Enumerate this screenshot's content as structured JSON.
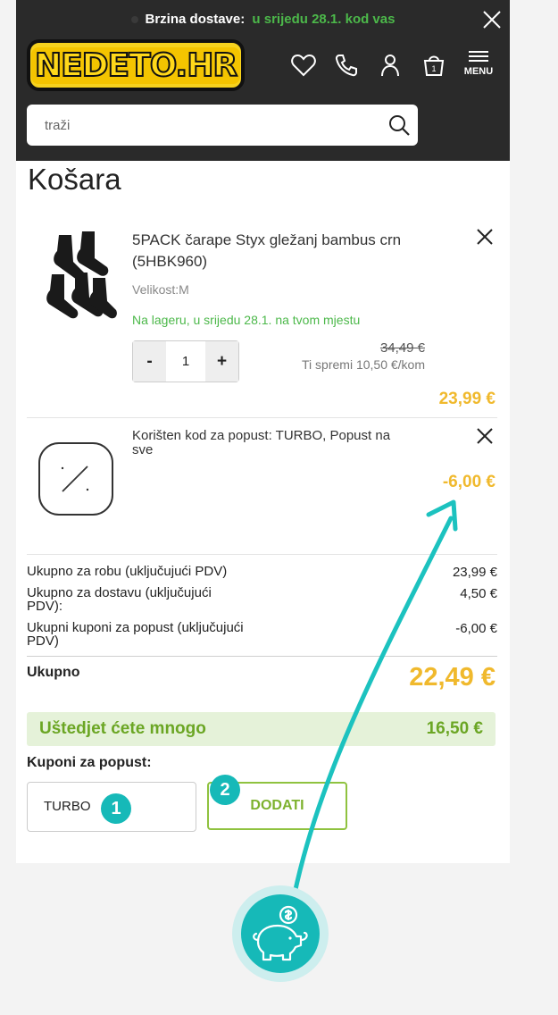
{
  "header": {
    "delivery_label": "Brzina dostave:",
    "delivery_value": "u srijedu 28.1. kod vas",
    "logo_text": "NEDETO.HR",
    "menu_label": "MENU"
  },
  "search": {
    "placeholder": "traži"
  },
  "page": {
    "title": "Košara"
  },
  "cart_item": {
    "name": "5PACK čarape Styx gležanj bambus crn (5HBK960)",
    "size": "Velikost:M",
    "stock": "Na lageru, u srijedu 28.1. na tvom mjestu",
    "qty_minus": "-",
    "qty_value": "1",
    "qty_plus": "+",
    "old_price": "34,49 €",
    "save_per_unit": "Ti spremi 10,50 €/kom",
    "price": "23,99 €"
  },
  "coupon_item": {
    "text": "Korišten kod za popust: TURBO, Popust na sve",
    "price": "-6,00 €"
  },
  "summary": {
    "goods_label": "Ukupno za robu (uključujući PDV)",
    "goods_value": "23,99 €",
    "shipping_label": "Ukupno za dostavu (uključujući PDV):",
    "shipping_value": "4,50 €",
    "coupons_label": "Ukupni kuponi za popust (uključujući PDV)",
    "coupons_value": "-6,00 €",
    "total_label": "Ukupno",
    "total_value": "22,49 €"
  },
  "savings": {
    "label": "Uštedjet ćete mnogo",
    "value": "16,50 €"
  },
  "discount": {
    "label": "Kuponi za popust:",
    "input_value": "TURBO",
    "add_label": "DODATI",
    "step1": "1",
    "step2": "2"
  },
  "colors": {
    "header_bg": "#2a2a2a",
    "green": "#4cb84a",
    "price_yellow": "#f0b92d",
    "teal": "#16b9b8"
  },
  "icons": [
    "close-icon",
    "heart-icon",
    "phone-icon",
    "user-icon",
    "basket-icon",
    "menu-icon",
    "search-icon",
    "piggy-bank-icon",
    "coupon-icon"
  ]
}
